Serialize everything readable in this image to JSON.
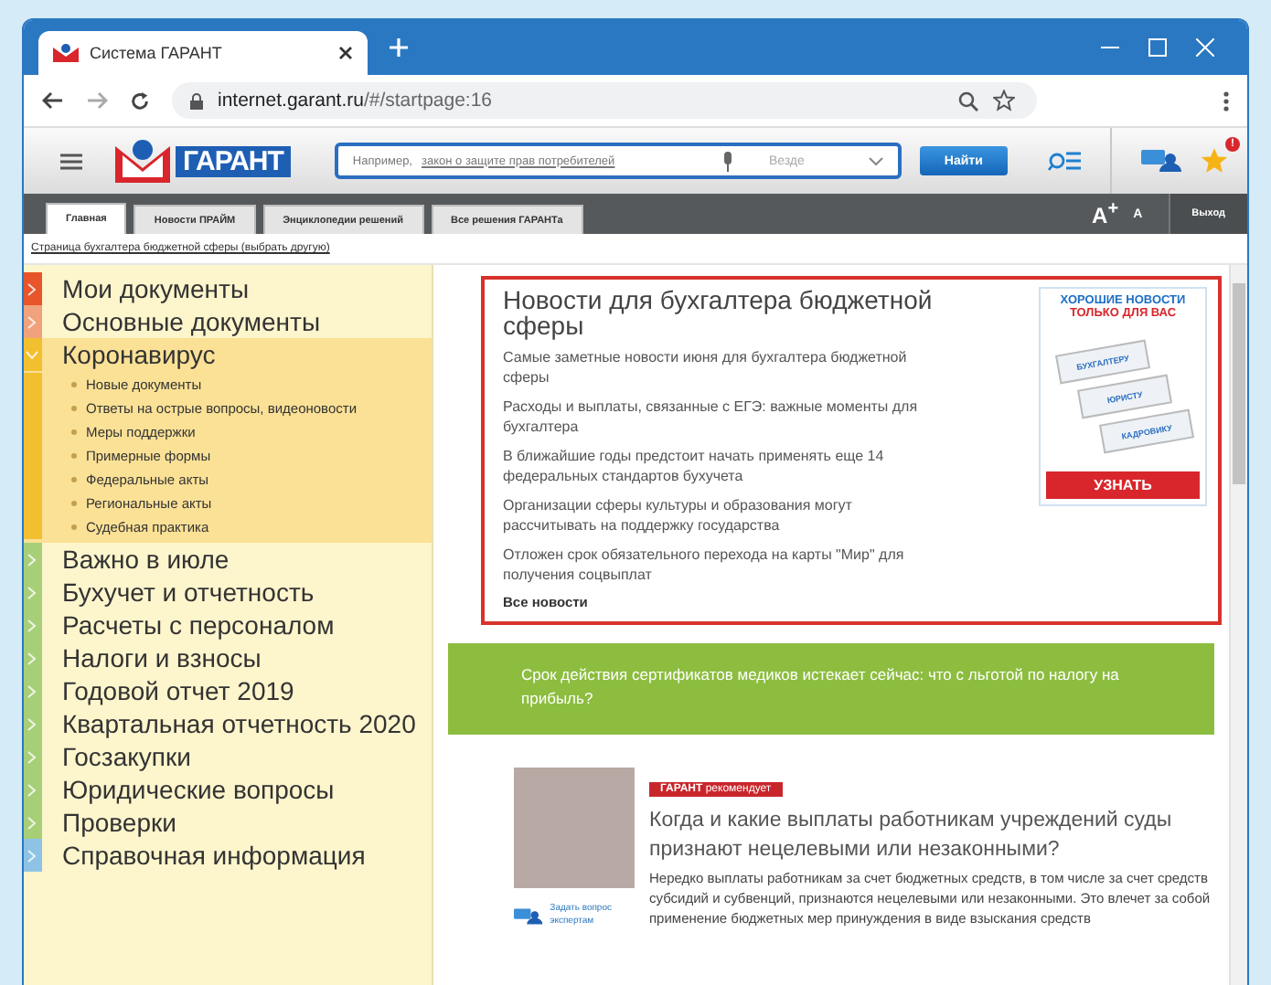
{
  "browser": {
    "tab_title": "Система ГАРАНТ",
    "url_host": "internet.garant.ru",
    "url_path": "/#/startpage:16"
  },
  "header": {
    "logo_text": "ГАРАНТ",
    "search_hint": "Например,",
    "search_example": "закон о защите прав потребителей",
    "scope": "Везде",
    "search_button": "Найти",
    "notification_badge": "!"
  },
  "nav": {
    "tabs": [
      {
        "label": "Главная",
        "selected": true
      },
      {
        "label": "Новости ПРАЙМ",
        "selected": false
      },
      {
        "label": "Энциклопедии решений",
        "selected": false
      },
      {
        "label": "Все решения ГАРАНТа",
        "selected": false
      }
    ],
    "font_larger": "A$^{+}$",
    "font_smaller": "A",
    "logout": "Выход"
  },
  "breadcrumb": "Страница бухгалтера бюджетной сферы (выбрать другую)",
  "sidebar": {
    "items": [
      {
        "label": "Мои документы",
        "color": "#e8552a",
        "expanded": false
      },
      {
        "label": "Основные документы",
        "color": "#f0a27c",
        "expanded": false
      },
      {
        "label": "Коронавирус",
        "color": "#f2bf2f",
        "expanded": true,
        "children": [
          "Новые документы",
          "Ответы на острые вопросы, видеоновости",
          "Меры поддержки",
          "Примерные формы",
          "Федеральные акты",
          "Региональные акты",
          "Судебная практика"
        ]
      },
      {
        "label": "Важно в июле",
        "color": "#a7cf78",
        "expanded": false
      },
      {
        "label": "Бухучет и отчетность",
        "color": "#a7cf78",
        "expanded": false
      },
      {
        "label": "Расчеты с персоналом",
        "color": "#a7cf78",
        "expanded": false
      },
      {
        "label": "Налоги и взносы",
        "color": "#a7cf78",
        "expanded": false
      },
      {
        "label": "Годовой отчет 2019",
        "color": "#a7cf78",
        "expanded": false
      },
      {
        "label": "Квартальная отчетность 2020",
        "color": "#a7cf78",
        "expanded": false
      },
      {
        "label": "Госзакупки",
        "color": "#a7cf78",
        "expanded": false
      },
      {
        "label": "Юридические вопросы",
        "color": "#a7cf78",
        "expanded": false
      },
      {
        "label": "Проверки",
        "color": "#a7cf78",
        "expanded": false
      },
      {
        "label": "Справочная информация",
        "color": "#8ec3e6",
        "expanded": false
      }
    ]
  },
  "news": {
    "title": "Новости для бухгалтера бюджетной сферы",
    "items": [
      "Самые заметные новости июня для бухгалтера бюджетной сферы",
      "Расходы и выплаты, связанные с ЕГЭ: важные моменты для бухгалтера",
      "В ближайшие годы предстоит начать применять еще 14 федеральных стандартов бухучета",
      "Организации сферы культуры и образования могут рассчитывать на поддержку государства",
      "Отложен срок обязательного перехода на карты \"Мир\" для получения соцвыплат"
    ],
    "all_link": "Все новости",
    "ad": {
      "line_1": "ХОРОШИЕ НОВОСТИ",
      "line_2": "ТОЛЬКО ДЛЯ ВАС",
      "papers": [
        "БУХГАЛТЕРУ",
        "ЮРИСТУ",
        "КАДРОВИКУ"
      ],
      "button": "УЗНАТЬ"
    }
  },
  "banner": "Срок действия сертификатов медиков истекает сейчас: что с льготой по налогу на прибыль?",
  "article": {
    "tag": "**ГАРАНТ** рекомендует",
    "title": "Когда и какие выплаты работникам учреждений суды признают нецелевыми или незаконными?",
    "body": "Нередко выплаты работникам за счет бюджетных средств, в том числе за счет средств субсидий и субвенций, признаются нецелевыми или незаконными. Это влечет за собой применение бюджетных мер принуждения в виде взыскания средств",
    "ask_expert": "Задать вопрос экспертам"
  }
}
